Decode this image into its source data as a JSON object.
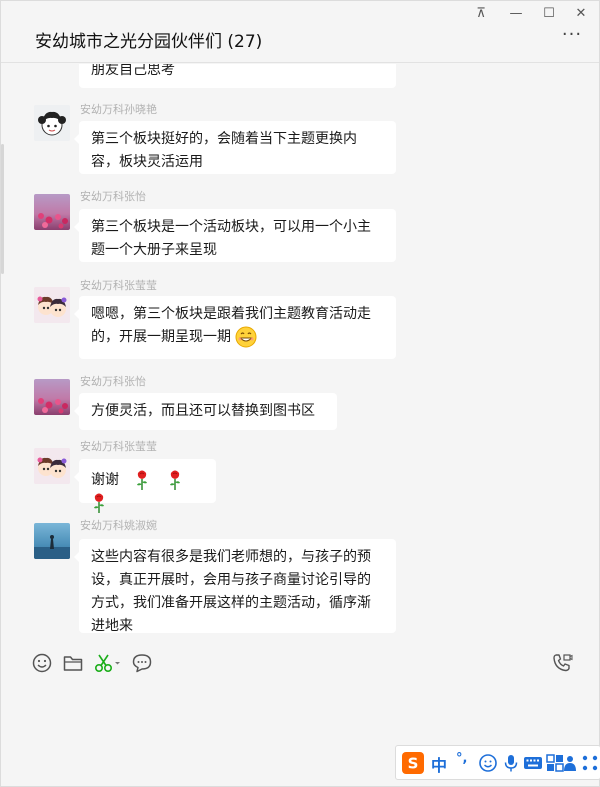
{
  "window": {
    "title": "安幼城市之光分园伙伴们 (27)",
    "controls": {
      "pin": "⊼",
      "minimize": "—",
      "maximize": "☐",
      "close": "✕"
    },
    "more": "···"
  },
  "messages": [
    {
      "sender": "",
      "text": "朋友自己思考",
      "avatar": "none"
    },
    {
      "sender": "安幼万科孙晓艳",
      "text": "第三个板块挺好的，会随着当下主题更换内容，板块灵活运用",
      "avatar": "girl-cartoon"
    },
    {
      "sender": "安幼万科张怡",
      "text": "第三个板块是一个活动板块，可以用一个小主题一个大册子来呈现",
      "avatar": "flowers-photo"
    },
    {
      "sender": "安幼万科张莹莹",
      "text": "嗯嗯，第三个板块是跟着我们主题教育活动走的，开展一期呈现一期",
      "avatar": "kids-cartoon",
      "emoji": "smile-emoji"
    },
    {
      "sender": "安幼万科张怡",
      "text": "方便灵活，而且还可以替换到图书区",
      "avatar": "flowers-photo"
    },
    {
      "sender": "安幼万科张莹莹",
      "text": "谢谢",
      "avatar": "kids-cartoon",
      "emoji": "rose-emoji"
    },
    {
      "sender": "安幼万科姚淑婉",
      "text": "这些内容有很多是我们老师想的，与孩子的预设，真正开展时，会用与孩子商量讨论引导的方式，我们准备开展这样的主题活动，循序渐进地来",
      "avatar": "sea-photo"
    }
  ],
  "toolbar": {
    "icons": [
      "emoji-icon",
      "folder-icon",
      "screenshot-icon",
      "chat-history-icon",
      "video-call-icon"
    ]
  },
  "ime": {
    "mode": "中",
    "punct": "°,",
    "icons": [
      "sogou-logo-icon",
      "emoji-face-icon",
      "microphone-icon",
      "keyboard-icon",
      "grid-icon",
      "person-icon",
      "shirt-icon",
      "apps-icon"
    ]
  },
  "colors": {
    "window_bg": "#f5f5f5",
    "bubble": "#ffffff",
    "sender": "#b2b2b2",
    "screenshot_icon": "#1aad19",
    "ime_accent": "#ff6a00",
    "ime_blue": "#1e6fd9"
  }
}
